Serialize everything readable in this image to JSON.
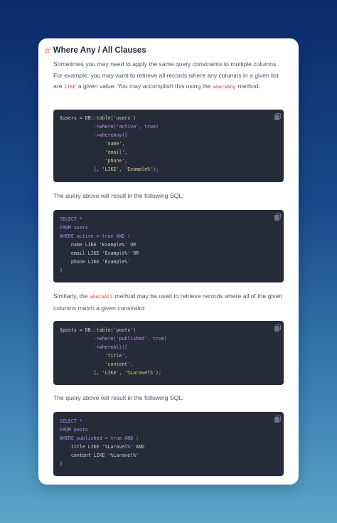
{
  "heading": {
    "hash": "#",
    "title": "Where Any / All Clauses"
  },
  "paragraphs": [
    {
      "parts": [
        "Sometimes you may need to apply the same query constraints to multiple columns. For example, you may want to retrieve all records where any columns in a given list are ",
        "LIKE",
        " a given value. You may accomplish this using the ",
        "whereAny",
        " method:"
      ]
    },
    {
      "parts": [
        "The query above will result in the following SQL:"
      ]
    },
    {
      "parts": [
        "Similarly, the ",
        "whereAll",
        " method may be used to retrieve records where all of the given columns match a given constraint:"
      ]
    },
    {
      "parts": [
        "The query above will result in the following SQL:"
      ]
    }
  ],
  "code_blocks": [
    {
      "lines": [
        "$users = DB::table('users')",
        "            ->where('active', true)",
        "            ->whereAny([",
        "                'name',",
        "                'email',",
        "                'phone',",
        "            ], 'LIKE', 'Example%');"
      ]
    },
    {
      "lines": [
        "SELECT *",
        "FROM users",
        "WHERE active = true AND (",
        "    name LIKE 'Example%' OR",
        "    email LIKE 'Example%' OR",
        "    phone LIKE 'Example%'",
        ")"
      ]
    },
    {
      "lines": [
        "$posts = DB::table('posts')",
        "            ->where('published', true)",
        "            ->whereAll([",
        "                'title',",
        "                'content',",
        "            ], 'LIKE', '%Laravel%');"
      ]
    },
    {
      "lines": [
        "SELECT *",
        "FROM posts",
        "WHERE published = true AND (",
        "    title LIKE '%Laravel%' AND",
        "    content LIKE '%Laravel%'",
        ")"
      ]
    }
  ],
  "icons": {
    "copy": "copy-icon"
  },
  "colors": {
    "background_top": "#0c2a6b",
    "background_bottom": "#5aa6c9",
    "code_bg": "#252b38",
    "accent": "#f4a3a0"
  }
}
